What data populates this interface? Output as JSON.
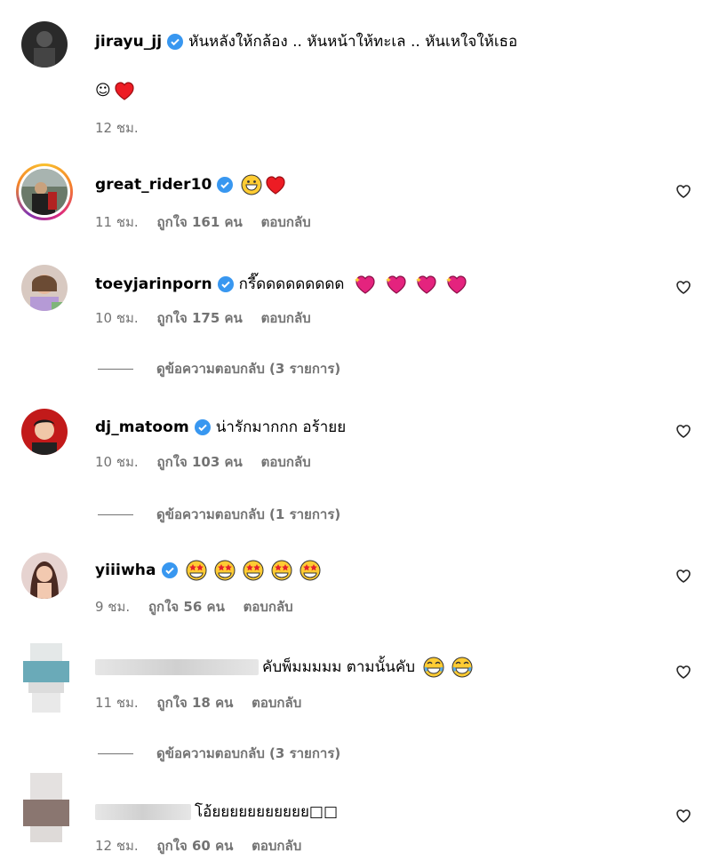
{
  "comments": [
    {
      "username": "jirayu_jj",
      "text": "หันหลังให้กล้อง .. หันหน้าให้ทะเล .. หันเหใจให้เธอ",
      "text2": "☺",
      "time": "12 ชม."
    },
    {
      "username": "great_rider10",
      "text": "",
      "time": "11 ชม.",
      "likes": "ถูกใจ 161 คน",
      "reply": "ตอบกลับ"
    },
    {
      "username": "toeyjarinporn",
      "text": "กรี๊ดดดดดดดดด",
      "time": "10 ชม.",
      "likes": "ถูกใจ 175 คน",
      "reply": "ตอบกลับ",
      "view_replies": "ดูข้อความตอบกลับ (3 รายการ)"
    },
    {
      "username": "dj_matoom",
      "text": "น่ารักมากกก อร้ายย",
      "time": "10 ชม.",
      "likes": "ถูกใจ 103 คน",
      "reply": "ตอบกลับ",
      "view_replies": "ดูข้อความตอบกลับ (1 รายการ)"
    },
    {
      "username": "yiiiwha",
      "text": "",
      "time": "9 ชม.",
      "likes": "ถูกใจ 56 คน",
      "reply": "ตอบกลับ"
    },
    {
      "username": "",
      "text": "คับพ็มมมมม ตามนั้นคับ",
      "time": "11 ชม.",
      "likes": "ถูกใจ 18 คน",
      "reply": "ตอบกลับ",
      "view_replies": "ดูข้อความตอบกลับ (3 รายการ)"
    },
    {
      "username": "",
      "text": "โอ้ยยยยยยยยยยย□□",
      "time": "12 ชม.",
      "likes": "ถูกใจ 60 คน",
      "reply": "ตอบกลับ"
    }
  ],
  "colors": {
    "verified": "#3897f0",
    "meta": "#737373",
    "heart": "#ed1c24"
  }
}
